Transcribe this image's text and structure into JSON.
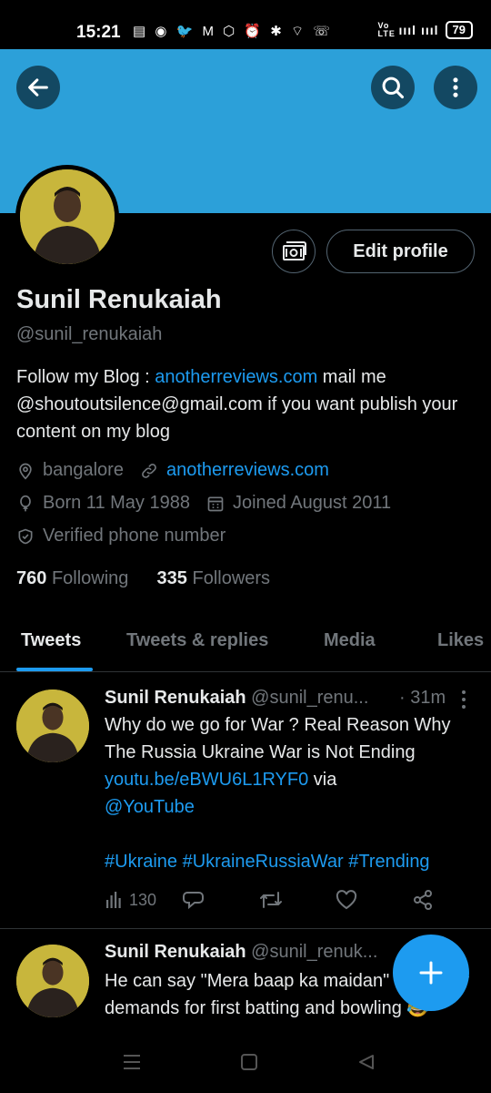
{
  "status_bar": {
    "time": "15:21",
    "icons": "▤ ◉ 🐦 M ⬡ ⏰ ✱ ⌔ ☏",
    "network": "Vo LTE",
    "signal": "ıııl ıııl",
    "battery": "79"
  },
  "header": {
    "banner_color": "#2ca0d9",
    "back_icon": "arrow-left",
    "search_icon": "search",
    "more_icon": "more-vertical"
  },
  "profile": {
    "name": "Sunil Renukaiah",
    "handle": "@sunil_renukaiah",
    "edit_button": "Edit profile",
    "bio_prefix": "Follow my Blog : ",
    "bio_link": "anotherreviews.com",
    "bio_suffix": "  mail me @shoutoutsilence@gmail.com if you want publish your content on my blog",
    "location": "bangalore",
    "website": "anotherreviews.com",
    "born": "Born 11 May 1988",
    "joined": "Joined August 2011",
    "verified": "Verified phone number",
    "following_count": "760",
    "following_label": "Following",
    "followers_count": "335",
    "followers_label": "Followers"
  },
  "tabs": [
    {
      "label": "Tweets",
      "active": true
    },
    {
      "label": "Tweets & replies"
    },
    {
      "label": "Media"
    },
    {
      "label": "Likes"
    }
  ],
  "tweets": [
    {
      "name": "Sunil Renukaiah",
      "handle": "@sunil_renu...",
      "time": "· 31m",
      "text_1": "Why do we go for War ? Real Reason Why The Russia Ukraine War is Not Ending ",
      "link": "youtu.be/eBWU6L1RYF0",
      "text_2": " via ",
      "mention": "@YouTube",
      "hashtags": "#Ukraine #UkraineRussiaWar #Trending",
      "views": "130"
    },
    {
      "name": "Sunil Renukaiah",
      "handle": "@sunil_renuk...",
      "text": "He can say \"Mera baap ka maidan\" Definitely demands for first batting and bowling 😂"
    }
  ],
  "colors": {
    "accent": "#1d9bf0",
    "muted": "#71767b",
    "text": "#e7e9ea",
    "border": "#2f3336"
  }
}
